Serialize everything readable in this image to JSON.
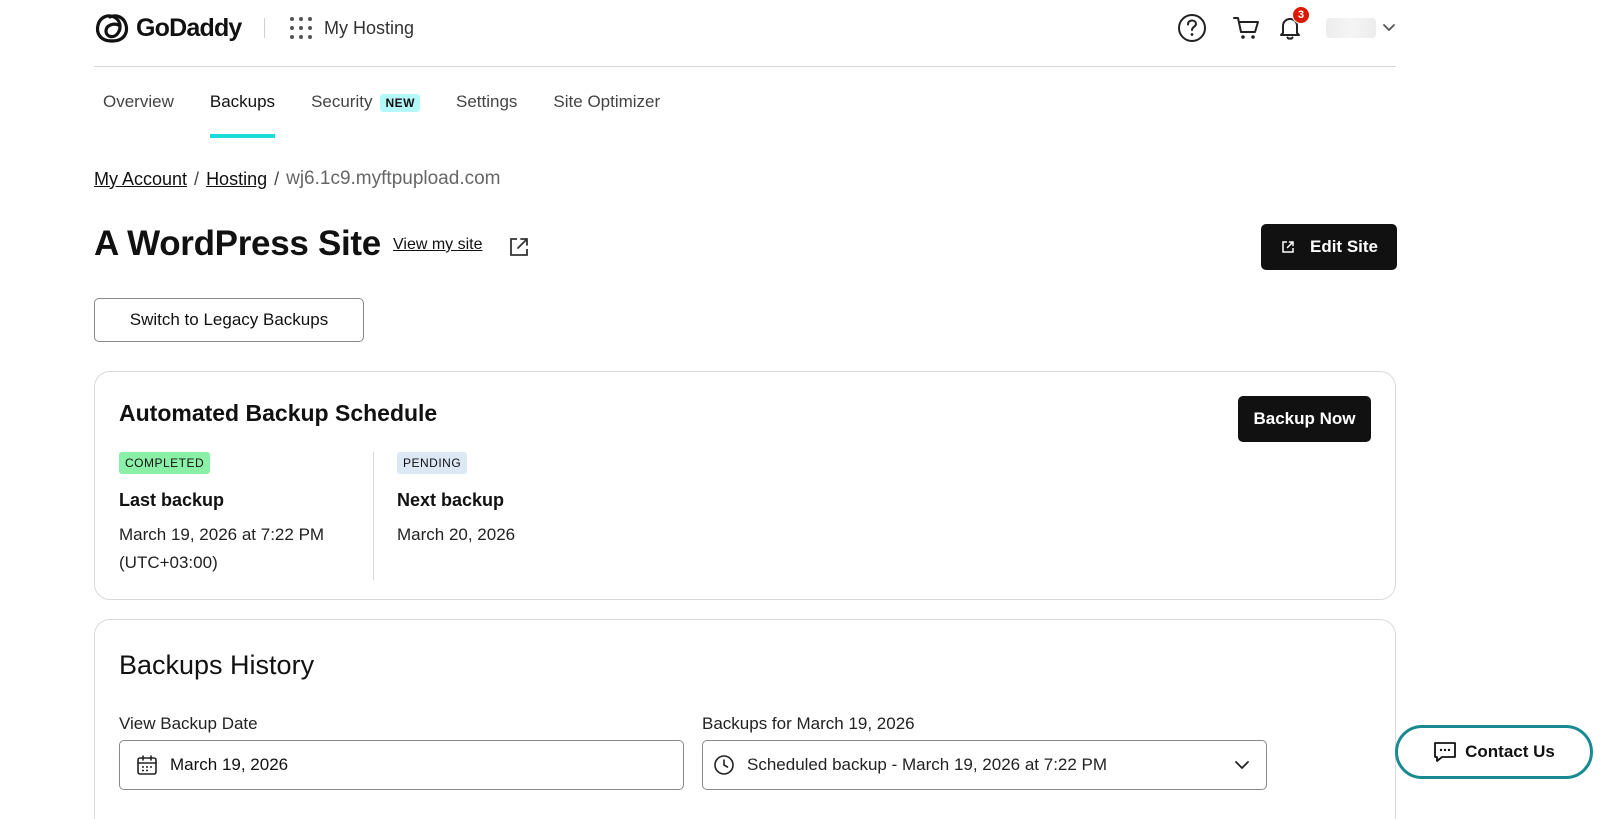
{
  "header": {
    "brand": "GoDaddy",
    "app_switcher_label": "My Hosting",
    "notifications_count": "3"
  },
  "tabs": [
    {
      "label": "Overview",
      "active": false
    },
    {
      "label": "Backups",
      "active": true
    },
    {
      "label": "Security",
      "badge": "NEW",
      "active": false
    },
    {
      "label": "Settings",
      "active": false
    },
    {
      "label": "Site Optimizer",
      "active": false
    }
  ],
  "breadcrumb": {
    "items": [
      "My Account",
      "Hosting"
    ],
    "separator": "/",
    "current": "wj6.1c9.myftpupload.com"
  },
  "page": {
    "title": "A WordPress Site",
    "view_site_link": "View my site",
    "edit_button": "Edit Site",
    "legacy_button": "Switch to Legacy Backups"
  },
  "schedule": {
    "title": "Automated Backup Schedule",
    "backup_now_button": "Backup Now",
    "last": {
      "status": "COMPLETED",
      "heading": "Last backup",
      "date": "March 19, 2026 at 7:22 PM",
      "timezone": "(UTC+03:00)"
    },
    "next": {
      "status": "PENDING",
      "heading": "Next backup",
      "date": "March 20, 2026"
    }
  },
  "history": {
    "title": "Backups History",
    "date_label": "View Backup Date",
    "date_value": "March 19, 2026",
    "backups_label": "Backups for March 19, 2026",
    "backups_selected": "Scheduled backup - March 19, 2026 at 7:22 PM"
  },
  "contact": {
    "label": "Contact Us"
  },
  "colors": {
    "tab_indicator": "#1bdbdb",
    "completed_chip": "#8bf0a7",
    "pending_chip": "#dde8f5",
    "notification_badge": "#db1802",
    "contact_border": "#1a8a92",
    "primary_button": "#111111"
  }
}
